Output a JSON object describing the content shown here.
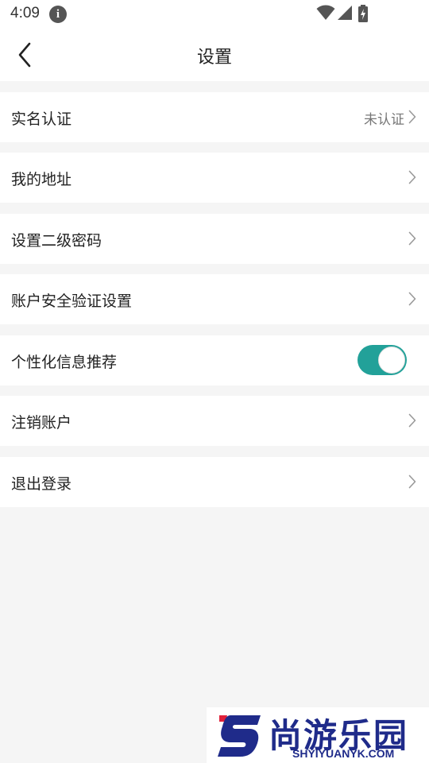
{
  "status_bar": {
    "time": "4:09",
    "info_icon": "info-icon",
    "icons": [
      "wifi-icon",
      "signal-icon",
      "battery-charging-icon"
    ]
  },
  "nav": {
    "title": "设置",
    "back_icon": "chevron-left-icon"
  },
  "rows": [
    {
      "label": "实名认证",
      "value": "未认证",
      "accessory": "chevron"
    },
    {
      "label": "我的地址",
      "accessory": "chevron"
    },
    {
      "label": "设置二级密码",
      "accessory": "chevron"
    },
    {
      "label": "账户安全验证设置",
      "accessory": "chevron"
    },
    {
      "label": "个性化信息推荐",
      "accessory": "toggle",
      "toggle_on": true
    },
    {
      "label": "注销账户",
      "accessory": "chevron"
    },
    {
      "label": "退出登录",
      "accessory": "chevron"
    }
  ],
  "colors": {
    "toggle_on": "#22a199",
    "watermark_blue": "#1f2b8a",
    "watermark_red": "#e0203a"
  },
  "watermark": {
    "logo_letter": "S",
    "chinese": "尚游乐园",
    "url": "SHYIYUANYK.COM"
  }
}
